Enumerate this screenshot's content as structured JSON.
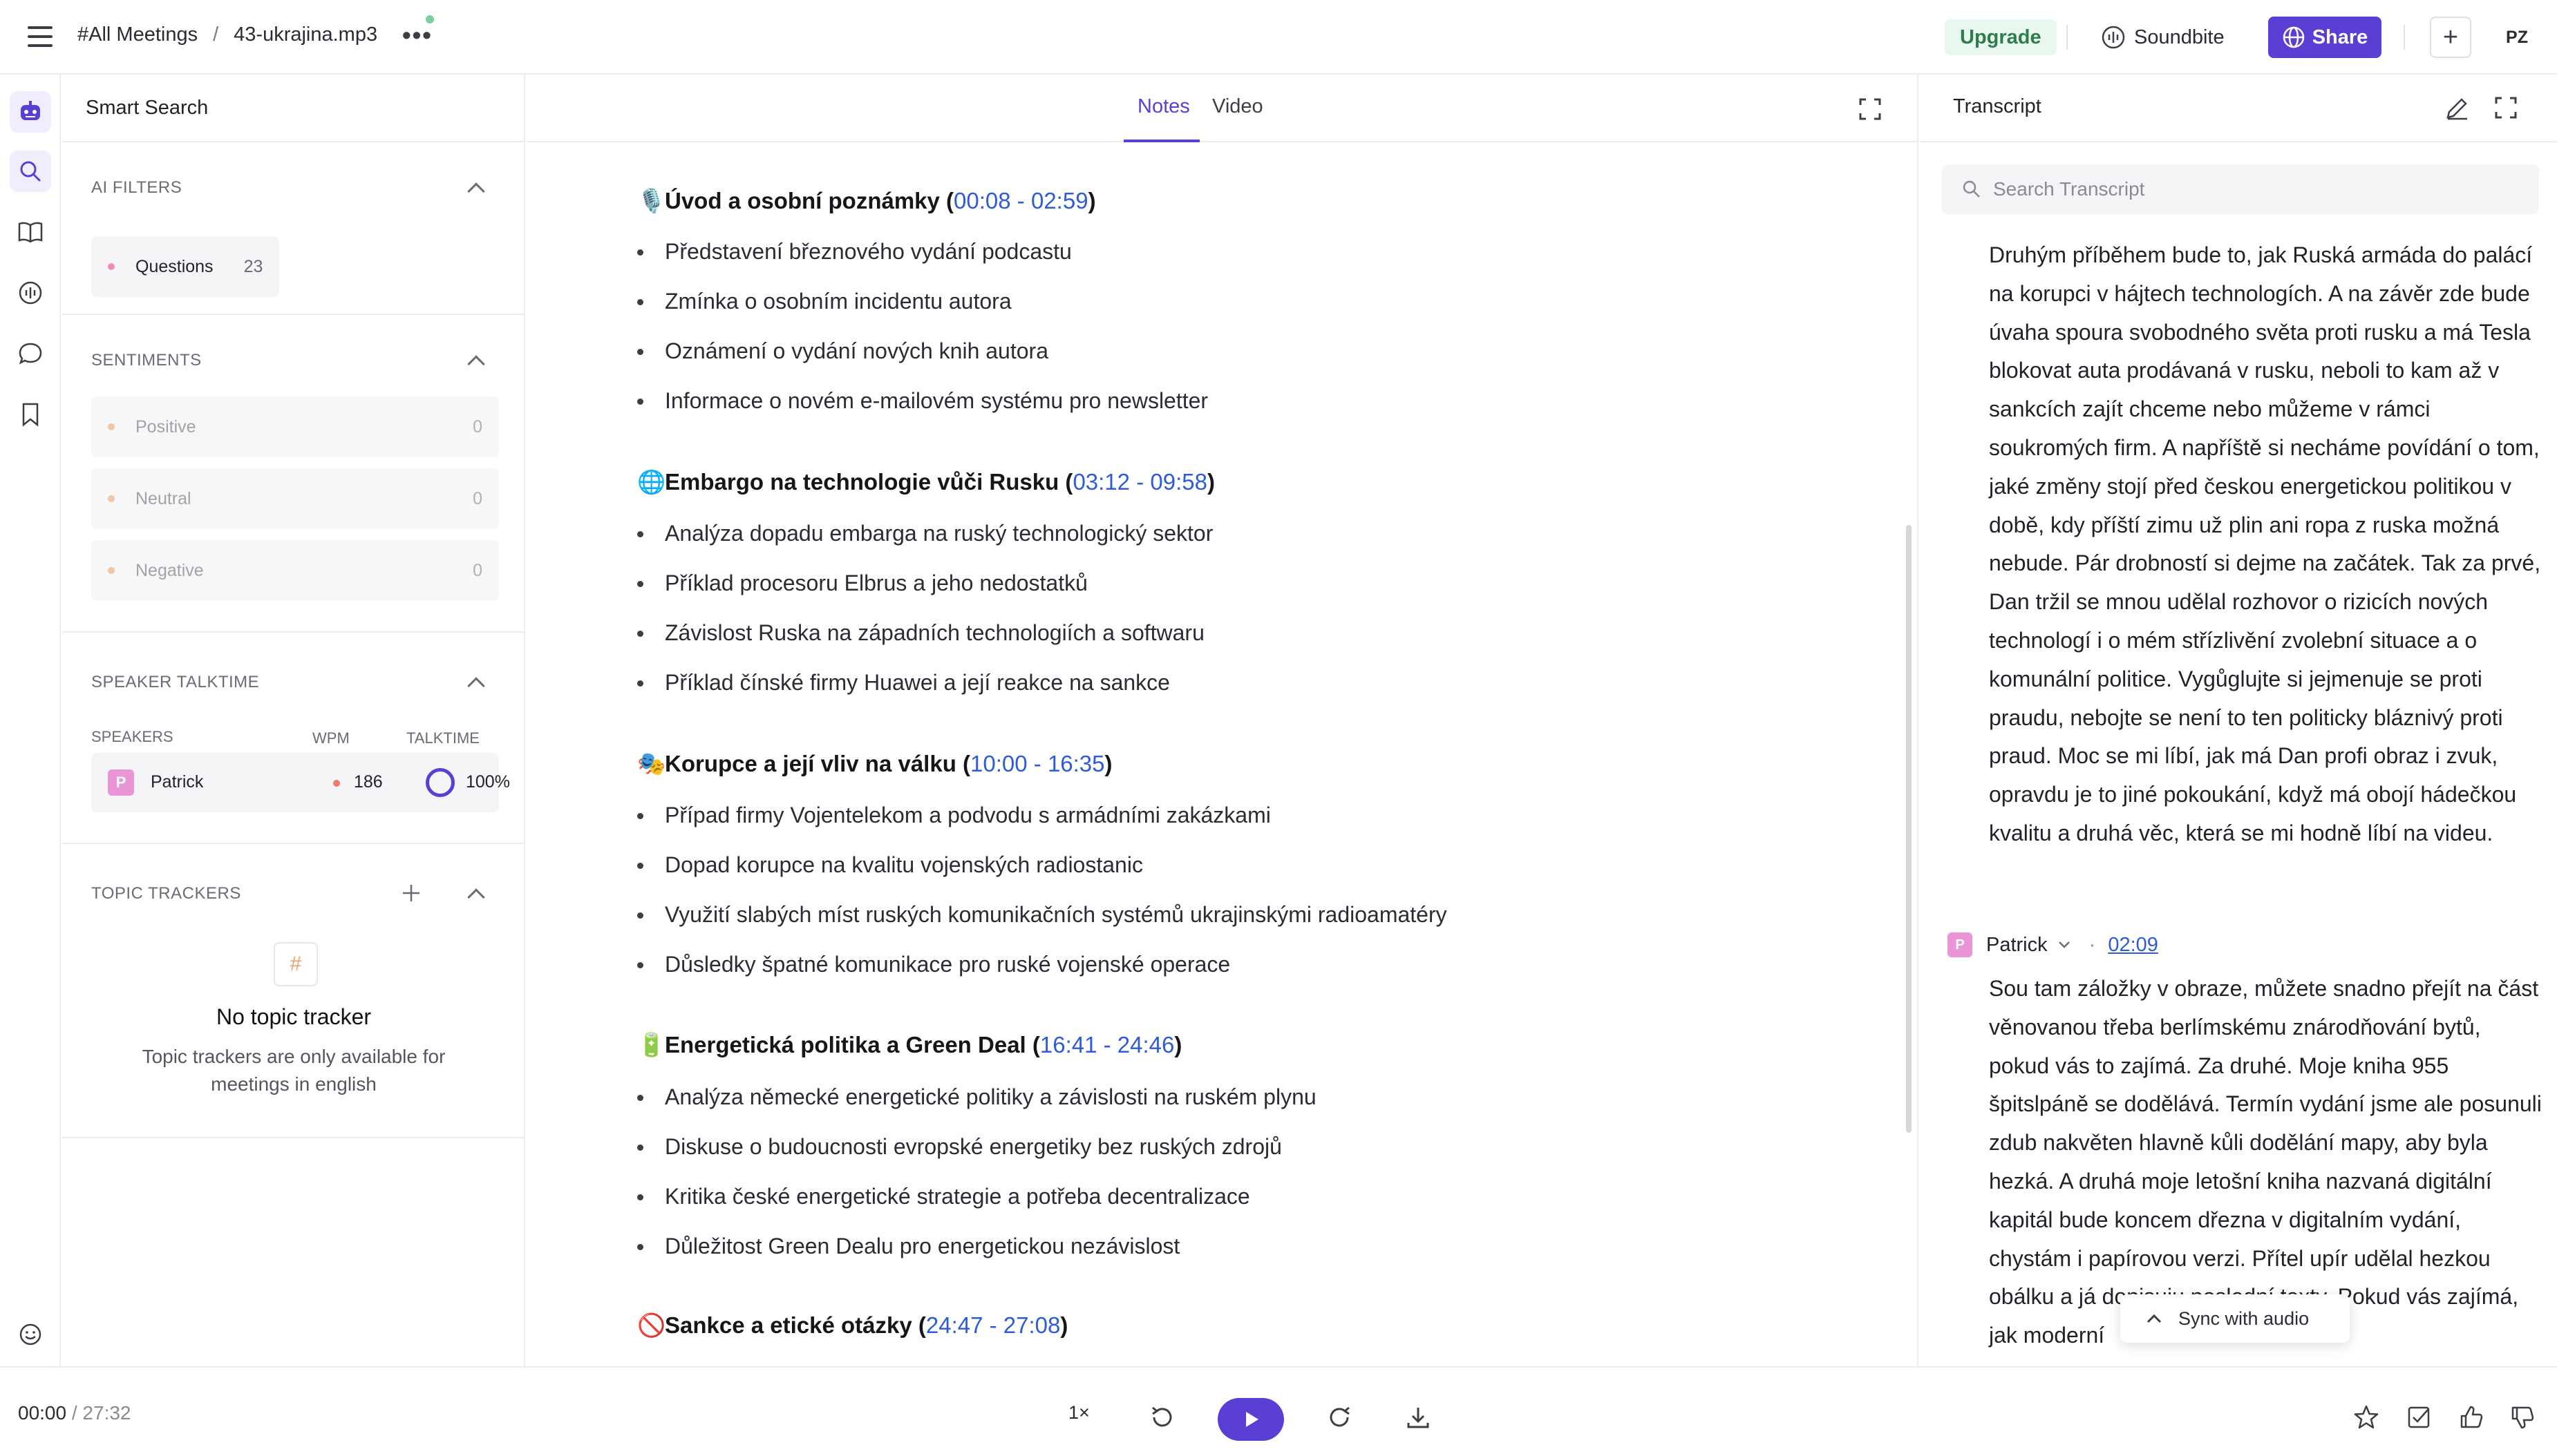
{
  "header": {
    "breadcrumb_root": "#All Meetings",
    "breadcrumb_sep": "/",
    "breadcrumb_file": "43-ukrajina.mp3",
    "more": "•••",
    "upgrade": "Upgrade",
    "soundbite": "Soundbite",
    "share": "Share",
    "add": "+",
    "avatar": "PZ"
  },
  "rail": {
    "icons": [
      "bot-icon",
      "search-icon",
      "book-icon",
      "audio-icon",
      "chat-icon",
      "bookmark-icon",
      "smile-icon"
    ]
  },
  "panel": {
    "title": "Smart Search",
    "ai_filters": {
      "title": "AI FILTERS",
      "chip_label": "Questions",
      "chip_count": "23"
    },
    "sentiments": {
      "title": "SENTIMENTS",
      "items": [
        {
          "label": "Positive",
          "count": "0"
        },
        {
          "label": "Neutral",
          "count": "0"
        },
        {
          "label": "Negative",
          "count": "0"
        }
      ]
    },
    "talktime": {
      "title": "SPEAKER TALKTIME",
      "col_speakers": "SPEAKERS",
      "col_wpm": "WPM",
      "col_talktime": "TALKTIME",
      "speaker_initial": "P",
      "speaker_name": "Patrick",
      "wpm": "186",
      "talktime_pct": "100%",
      "talktime_fraction": 1.0
    },
    "trackers": {
      "title": "TOPIC TRACKERS",
      "empty_icon": "#",
      "empty_title": "No topic tracker",
      "empty_sub": "Topic trackers are only available for meetings in english"
    }
  },
  "notes": {
    "tabs": [
      "Notes",
      "Video"
    ],
    "active_tab": "Notes",
    "sections": [
      {
        "emoji": "🎙️",
        "title": "Úvod a osobní poznámky (",
        "start": "00:08",
        "dash": " - ",
        "end": "02:59",
        "close": ")",
        "bullets": [
          "Představení březnového vydání podcastu",
          "Zmínka o osobním incidentu autora",
          "Oznámení o vydání nových knih autora",
          "Informace o novém e-mailovém systému pro newsletter"
        ]
      },
      {
        "emoji": "🌐",
        "title": "Embargo na technologie vůči Rusku (",
        "start": "03:12",
        "dash": " - ",
        "end": "09:58",
        "close": ")",
        "bullets": [
          "Analýza dopadu embarga na ruský technologický sektor",
          "Příklad procesoru Elbrus a jeho nedostatků",
          "Závislost Ruska na západních technologiích a softwaru",
          "Příklad čínské firmy Huawei a její reakce na sankce"
        ]
      },
      {
        "emoji": "🎭",
        "title": "Korupce a její vliv na válku (",
        "start": "10:00",
        "dash": " - ",
        "end": "16:35",
        "close": ")",
        "bullets": [
          "Případ firmy Vojentelekom a podvodu s armádními zakázkami",
          "Dopad korupce na kvalitu vojenských radiostanic",
          "Využití slabých míst ruských komunikačních systémů ukrajinskými radioamatéry",
          "Důsledky špatné komunikace pro ruské vojenské operace"
        ]
      },
      {
        "emoji": "🔋",
        "title": "Energetická politika a Green Deal (",
        "start": "16:41",
        "dash": " - ",
        "end": "24:46",
        "close": ")",
        "bullets": [
          "Analýza německé energetické politiky a závislosti na ruském plynu",
          "Diskuse o budoucnosti evropské energetiky bez ruských zdrojů",
          "Kritika české energetické strategie a potřeba decentralizace",
          "Důležitost Green Dealu pro energetickou nezávislost"
        ]
      },
      {
        "emoji": "🚫",
        "title": "Sankce a etické otázky (",
        "start": "24:47",
        "dash": " - ",
        "end": "27:08",
        "close": ")",
        "bullets": []
      }
    ]
  },
  "transcript": {
    "title": "Transcript",
    "search_placeholder": "Search Transcript",
    "para1": "Druhým příběhem bude to, jak Ruská armáda do palácí na korupci v hájtech technologích. A na závěr zde bude úvaha spoura svobodného světa proti rusku a má Tesla blokovat auta prodávaná v rusku, neboli to kam až v sankcích zajít chceme nebo můžeme v rámci soukromých firm. A napříště si necháme povídání o tom, jaké změny stojí před českou energetickou politikou v době, kdy příští zimu už plin ani ropa z ruska možná nebude. Pár drobností si dejme na začátek. Tak za prvé, Dan tržil se mnou udělal rozhovor o rizicích nových technologí i o mém střízlivění zvolební situace a o komunální politice. Vygůglujte si jejmenuje se proti praudu, nebojte se není to ten politicky bláznivý proti praud. Moc se mi líbí, jak má Dan profi obraz i zvuk, opravdu je to jiné pokoukání, když má obojí hádečkou kvalitu a druhá věc, která se mi hodně líbí na videu.",
    "speaker_initial": "P",
    "speaker": "Patrick",
    "timestamp": "02:09",
    "para2": "Sou tam záložky v obraze, můžete snadno přejít na část věnovanou třeba berlímskému znárodňování bytů, pokud vás to zajímá. Za druhé. Moje kniha 955 špitslpáně se dodělává. Termín vydání jsme ale posunuli zdub nakvěten hlavně kůli dodělání mapy, aby byla hezká. A druhá moje letošní kniha nazvaná digitální kapitál bude koncem dřezna v digitalním vydání, chystám i papírovou verzi. Přítel upír udělal hezkou obálku a já dopisuju poslední texty. Pokud vás zajímá, jak moderní",
    "sync_label": "Sync with audio"
  },
  "player": {
    "current": "00:00",
    "sep": " / ",
    "duration": "27:32",
    "speed": "1×",
    "progress_fraction": 0.0
  },
  "colors": {
    "accent": "#5b3fd4",
    "link": "#2e5bd6",
    "upgrade_bg": "#eaf7ef",
    "upgrade_text": "#2e7d4f"
  }
}
